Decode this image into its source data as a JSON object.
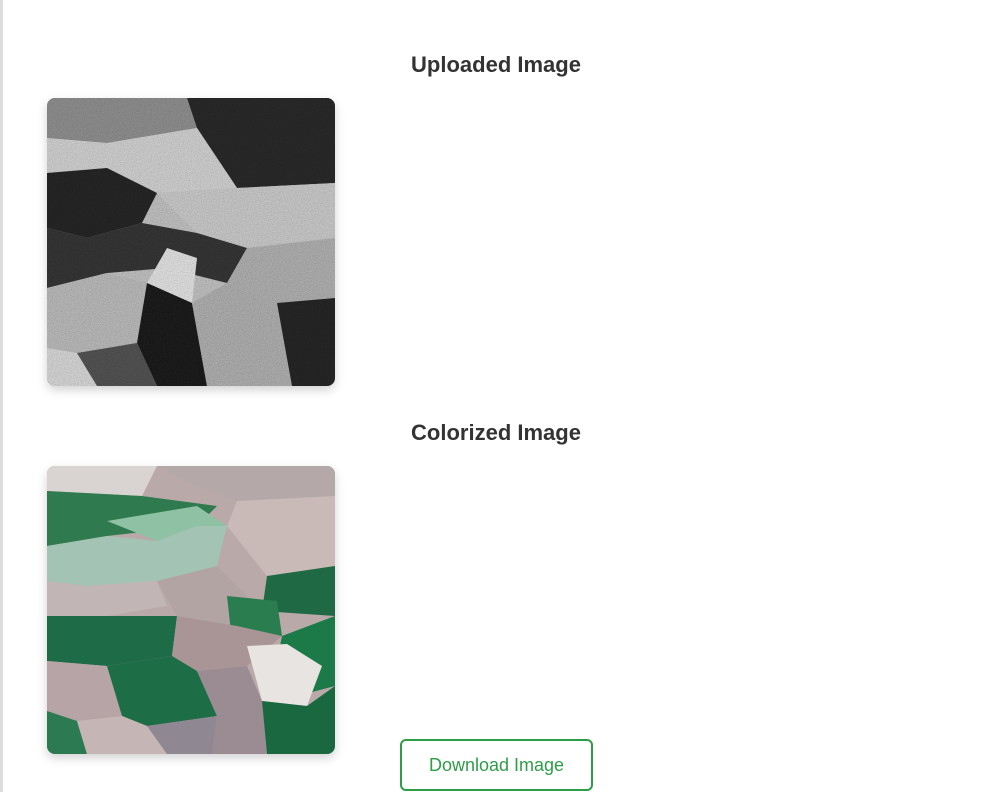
{
  "sections": {
    "uploaded_title": "Uploaded Image",
    "colorized_title": "Colorized Image"
  },
  "actions": {
    "download_label": "Download Image"
  },
  "colors": {
    "accent_green": "#2e9d48",
    "heading_text": "#333333"
  }
}
